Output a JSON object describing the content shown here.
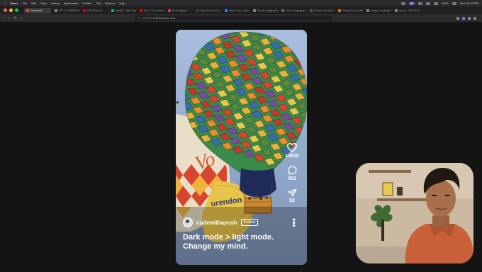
{
  "menubar": {
    "app": "Brave",
    "items": [
      "File",
      "Edit",
      "View",
      "History",
      "Bookmarks",
      "Profiles",
      "Tab",
      "Window",
      "Help"
    ],
    "badge": "23",
    "battery": "100%",
    "clock": "Mon 12:07 PM"
  },
  "tabs": [
    {
      "label": "Document",
      "color": "#e04b3a",
      "active": true
    },
    {
      "label": "127.0.0.1:5500/html",
      "color": "#888888"
    },
    {
      "label": "(16) Pinterest",
      "color": "#e60023"
    },
    {
      "label": "Spotify – Web Player",
      "color": "#1db954"
    },
    {
      "label": "Pat-Y: Ill be missing",
      "color": "#ff0000"
    },
    {
      "label": "(9) Instagram",
      "color": "#e1306c"
    },
    {
      "label": "Human in Rock Lev...",
      "color": "#444444"
    },
    {
      "label": "Watch now - Open r...",
      "color": "#3b82f6"
    },
    {
      "label": "Rerole vlogging/Rela...",
      "color": "#888888"
    },
    {
      "label": "Intro to engaging wr...",
      "color": "#666666"
    },
    {
      "label": "Create insta reels",
      "color": "#555555"
    },
    {
      "label": "Colorful font art illust...",
      "color": "#d97706"
    },
    {
      "label": "Images_chatwalk.com",
      "color": "#888888"
    },
    {
      "label": "shorts - 1021437485...",
      "color": "#888888"
    }
  ],
  "address": {
    "url": "127.0.0.1:5500/index.html"
  },
  "reel": {
    "username": "codewithayush",
    "follow_label": "Follow",
    "caption": "Dark mode > light mode. Change my mind.",
    "likes": "14820",
    "comments": "423",
    "shares": "92",
    "balloon_text": "urendon"
  },
  "colors": {
    "accent": "#8a6de0",
    "page_bg": "#141414"
  }
}
